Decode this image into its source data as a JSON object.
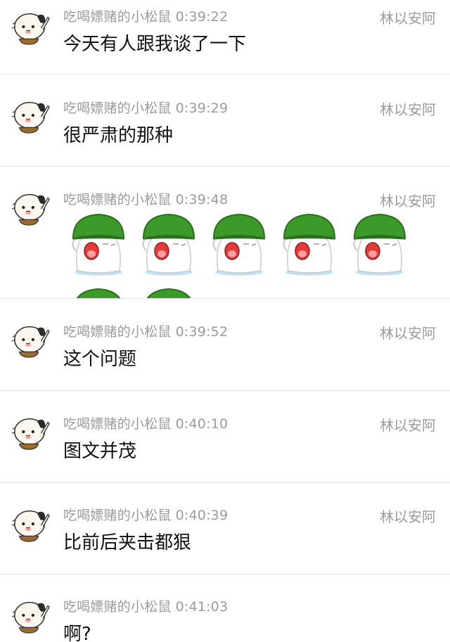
{
  "chat": {
    "messages": [
      {
        "sender": "吃喝嫖赌的小松鼠",
        "time": "0:39:22",
        "target": "林以安阿",
        "text": "今天有人跟我谈了一下"
      },
      {
        "sender": "吃喝嫖赌的小松鼠",
        "time": "0:39:29",
        "target": "林以安阿",
        "text": "很严肃的那种"
      },
      {
        "sender": "吃喝嫖赌的小松鼠",
        "time": "0:39:48",
        "target": "林以安阿",
        "sticker_count": 7
      },
      {
        "sender": "吃喝嫖赌的小松鼠",
        "time": "0:39:52",
        "target": "林以安阿",
        "text": "这个问题"
      },
      {
        "sender": "吃喝嫖赌的小松鼠",
        "time": "0:40:10",
        "target": "林以安阿",
        "text": "图文并茂"
      },
      {
        "sender": "吃喝嫖赌的小松鼠",
        "time": "0:40:39",
        "target": "林以安阿",
        "text": "比前后夹击都狠"
      },
      {
        "sender": "吃喝嫖赌的小松鼠",
        "time": "0:41:03",
        "text": "啊?"
      }
    ]
  },
  "icons": {
    "avatar": "panda-bear-avatar-icon",
    "sticker": "green-hat-crying-ghost-sticker"
  },
  "colors": {
    "meta_text": "#9b9b9b",
    "message_text": "#111111",
    "divider": "#e6e6e6",
    "sticker_hat": "#3c9a2a"
  }
}
